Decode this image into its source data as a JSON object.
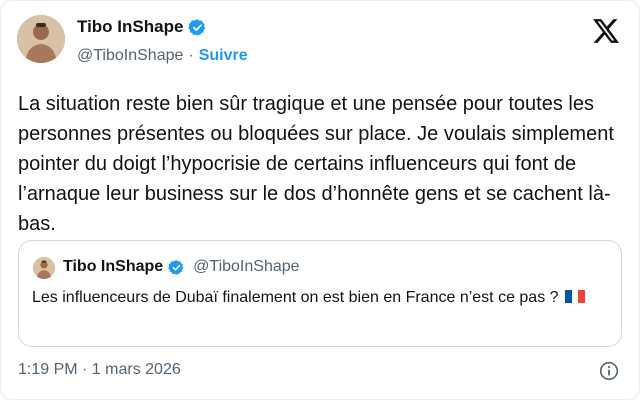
{
  "author": {
    "display_name": "Tibo InShape",
    "handle": "@TiboInShape",
    "separator": "·",
    "follow_label": "Suivre",
    "avatar_icon": "person-avatar"
  },
  "tweet": {
    "text": "La situation reste bien sûr tragique et une pensée pour toutes les personnes présentes ou bloquées sur place. Je voulais simplement pointer du doigt l’hypocrisie de certains influenceurs qui font de l’arnaque leur business sur le dos d’honnête gens et se cachent là-bas.",
    "timestamp": "1:19 PM · 1 mars 2026"
  },
  "quote": {
    "display_name": "Tibo InShape",
    "handle": "@TiboInShape",
    "text": "Les influenceurs de Dubaï finalement on est bien en France n’est ce pas ?",
    "flag_icon": "france-flag"
  },
  "icons": {
    "verified": "verified-badge-icon",
    "platform": "x-logo-icon",
    "info": "info-icon"
  },
  "colors": {
    "accent": "#1d9bf0",
    "muted": "#536471",
    "text": "#0f1419",
    "border": "#cfd9de"
  }
}
